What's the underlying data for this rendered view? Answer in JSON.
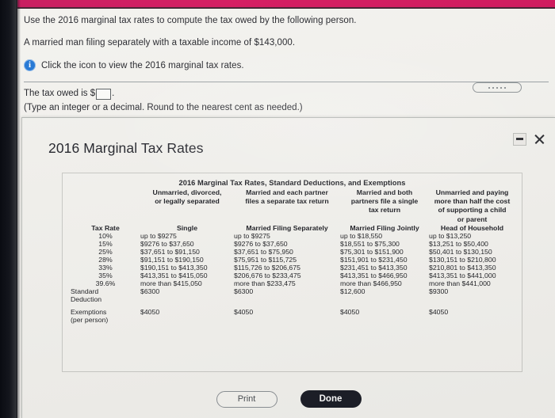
{
  "colors": {
    "accent_band": "#cf1359",
    "info_icon": "#1f74d4",
    "done_button": "#1b1e27",
    "page_background": "#f3f2ee"
  },
  "problem": {
    "instruction": "Use the 2016 marginal tax rates to compute the tax owed by the following person.",
    "scenario": "A married man filing separately with a taxable income of $143,000.",
    "icon_name": "info-icon",
    "icon_link_text": "Click the icon to view the 2016 marginal tax rates.",
    "answer_prefix": "The tax owed is $",
    "answer_suffix": ".",
    "answer_value": "",
    "answer_placeholder": "",
    "answer_hint": "(Type an integer or a decimal. Round to the nearest cent as needed.)"
  },
  "modal": {
    "title": "2016 Marginal Tax Rates",
    "minimize_label": "minimize-icon",
    "close_label": "close-icon",
    "footer": {
      "print_label": "Print",
      "done_label": "Done"
    }
  },
  "table": {
    "title": "2016 Marginal Tax Rates, Standard Deductions, and Exemptions",
    "descriptions": [
      "",
      "Unmarried, divorced,\nor legally separated",
      "Married and each partner\nfiles a separate tax return",
      "Married and both\npartners file a single\ntax return",
      "Unmarried and paying\nmore than half the cost\nof supporting a child\nor parent"
    ],
    "description_1": "Unmarried, divorced, or legally separated",
    "description_2": "Married and each partner files a separate tax return",
    "description_3": "Married and both partners file a single tax return",
    "description_4": "Unmarried and paying more than half the cost of supporting a child or parent",
    "headers": [
      "Tax Rate",
      "Single",
      "Married Filing Separately",
      "Married Filing Jointly",
      "Head of Household"
    ],
    "rows": [
      {
        "rate": "10%",
        "single": "up to $9275",
        "mfs": "up to $9275",
        "mfj": "up to $18,550",
        "hoh": "up to $13,250"
      },
      {
        "rate": "15%",
        "single": "$9276 to $37,650",
        "mfs": "$9276 to $37,650",
        "mfj": "$18,551 to $75,300",
        "hoh": "$13,251 to $50,400"
      },
      {
        "rate": "25%",
        "single": "$37,651 to $91,150",
        "mfs": "$37,651 to $75,950",
        "mfj": "$75,301 to $151,900",
        "hoh": "$50,401 to $130,150"
      },
      {
        "rate": "28%",
        "single": "$91,151 to $190,150",
        "mfs": "$75,951 to $115,725",
        "mfj": "$151,901 to $231,450",
        "hoh": "$130,151 to $210,800"
      },
      {
        "rate": "33%",
        "single": "$190,151 to $413,350",
        "mfs": "$115,726 to $206,675",
        "mfj": "$231,451 to $413,350",
        "hoh": "$210,801 to $413,350"
      },
      {
        "rate": "35%",
        "single": "$413,351 to $415,050",
        "mfs": "$206,676 to $233,475",
        "mfj": "$413,351 to $466,950",
        "hoh": "$413,351 to $441,000"
      },
      {
        "rate": "39.6%",
        "single": "more than $415,050",
        "mfs": "more than $233,475",
        "mfj": "more than $466,950",
        "hoh": "more than $441,000"
      }
    ],
    "standard_deduction": {
      "label_line1": "Standard",
      "label_line2": "Deduction",
      "single": "$6300",
      "mfs": "$6300",
      "mfj": "$12,600",
      "hoh": "$9300"
    },
    "exemptions": {
      "label_line1": "Exemptions",
      "label_line2": "(per person)",
      "single": "$4050",
      "mfs": "$4050",
      "mfj": "$4050",
      "hoh": "$4050"
    }
  }
}
